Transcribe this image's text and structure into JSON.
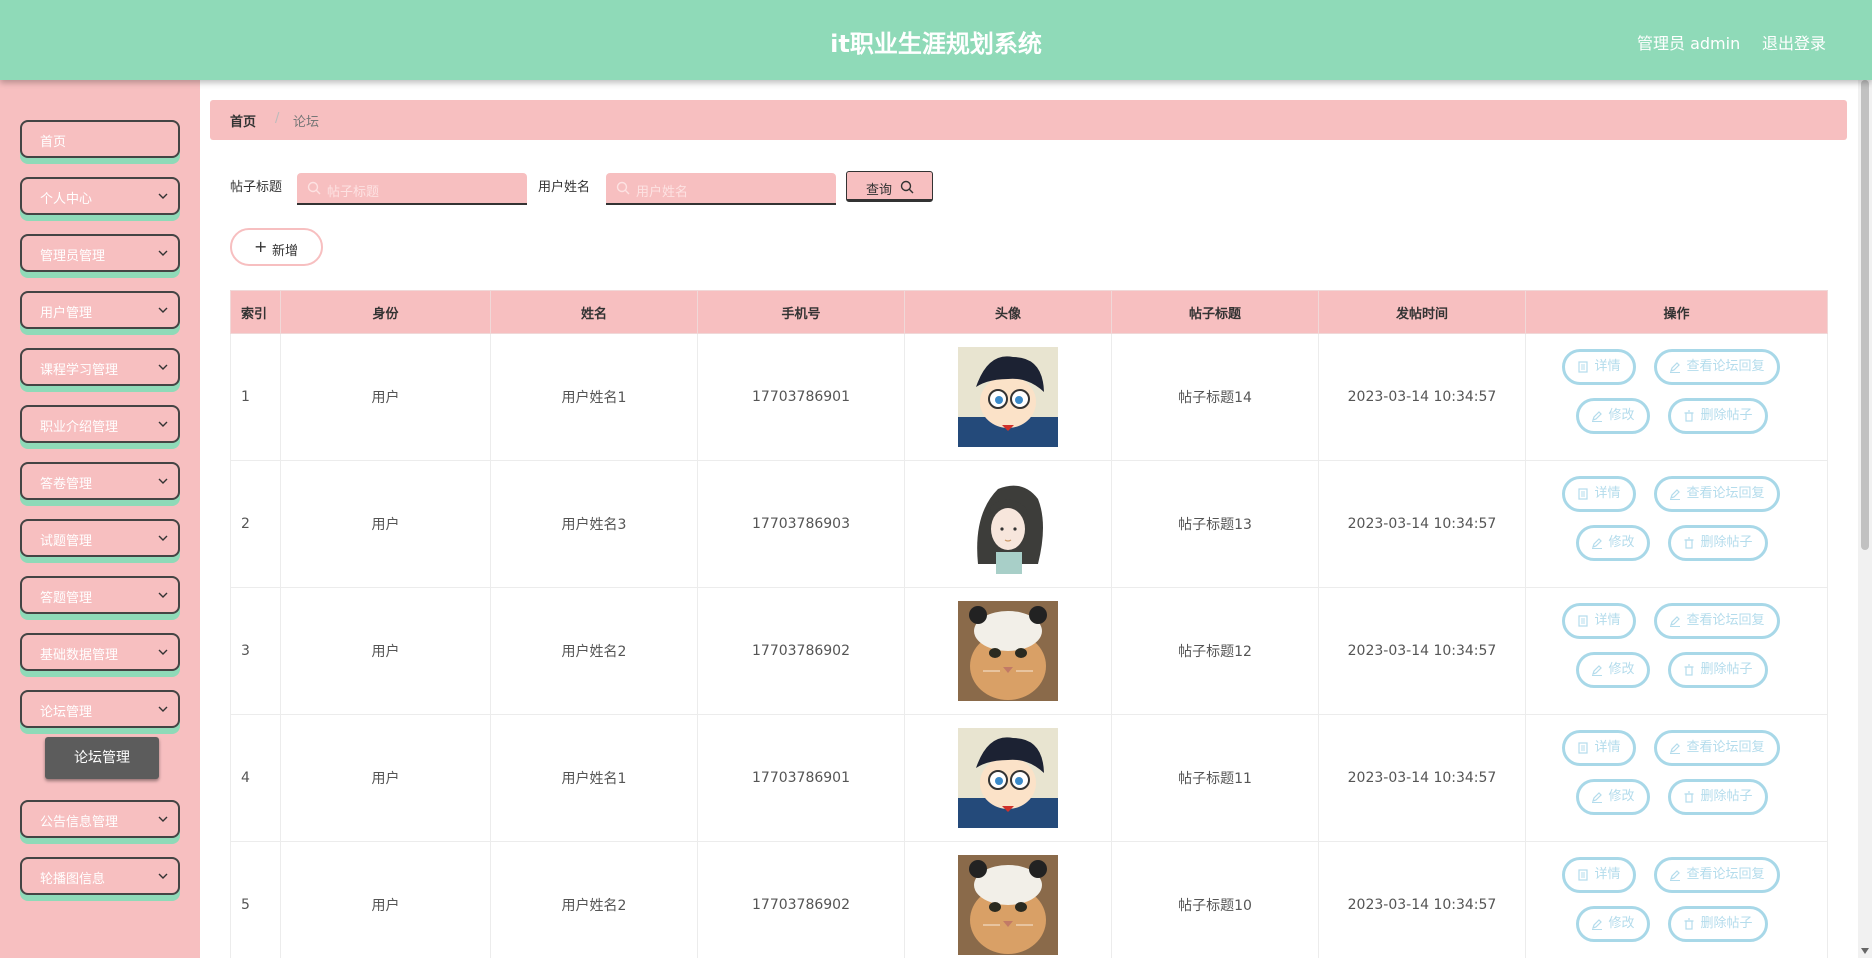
{
  "header": {
    "title": "it职业生涯规划系统",
    "admin_label": "管理员 admin",
    "logout_label": "退出登录"
  },
  "sidebar": {
    "items": [
      {
        "label": "首页"
      },
      {
        "label": "个人中心"
      },
      {
        "label": "管理员管理"
      },
      {
        "label": "用户管理"
      },
      {
        "label": "课程学习管理"
      },
      {
        "label": "职业介绍管理"
      },
      {
        "label": "答卷管理"
      },
      {
        "label": "试题管理"
      },
      {
        "label": "答题管理"
      },
      {
        "label": "基础数据管理"
      },
      {
        "label": "论坛管理"
      },
      {
        "label": "公告信息管理"
      },
      {
        "label": "轮播图信息"
      }
    ],
    "active_sub": "论坛管理"
  },
  "breadcrumb": {
    "home": "首页",
    "separator": "/",
    "current": "论坛"
  },
  "filters": {
    "title_label": "帖子标题",
    "title_placeholder": "帖子标题",
    "user_label": "用户姓名",
    "user_placeholder": "用户姓名",
    "query_label": "查询"
  },
  "add_label": "新增",
  "table": {
    "headers": [
      "索引",
      "身份",
      "姓名",
      "手机号",
      "头像",
      "帖子标题",
      "发帖时间",
      "操作"
    ],
    "rows": [
      {
        "index": "1",
        "role": "用户",
        "name": "用户姓名1",
        "phone": "17703786901",
        "avatar": "boy-avatar",
        "title": "帖子标题14",
        "time": "2023-03-14 10:34:57"
      },
      {
        "index": "2",
        "role": "用户",
        "name": "用户姓名3",
        "phone": "17703786903",
        "avatar": "girl-avatar",
        "title": "帖子标题13",
        "time": "2023-03-14 10:34:57"
      },
      {
        "index": "3",
        "role": "用户",
        "name": "用户姓名2",
        "phone": "17703786902",
        "avatar": "cat-avatar",
        "title": "帖子标题12",
        "time": "2023-03-14 10:34:57"
      },
      {
        "index": "4",
        "role": "用户",
        "name": "用户姓名1",
        "phone": "17703786901",
        "avatar": "boy-avatar",
        "title": "帖子标题11",
        "time": "2023-03-14 10:34:57"
      },
      {
        "index": "5",
        "role": "用户",
        "name": "用户姓名2",
        "phone": "17703786902",
        "avatar": "cat-avatar",
        "title": "帖子标题10",
        "time": "2023-03-14 10:34:57"
      }
    ],
    "actions": {
      "detail": "详情",
      "view": "查看论坛回复",
      "edit": "修改",
      "delete": "删除帖子"
    }
  },
  "colors": {
    "header": "#8fdab8",
    "sidebar": "#f7bfc0",
    "accent_pink": "#f7bfc0",
    "action_border": "#a8d8e8"
  }
}
